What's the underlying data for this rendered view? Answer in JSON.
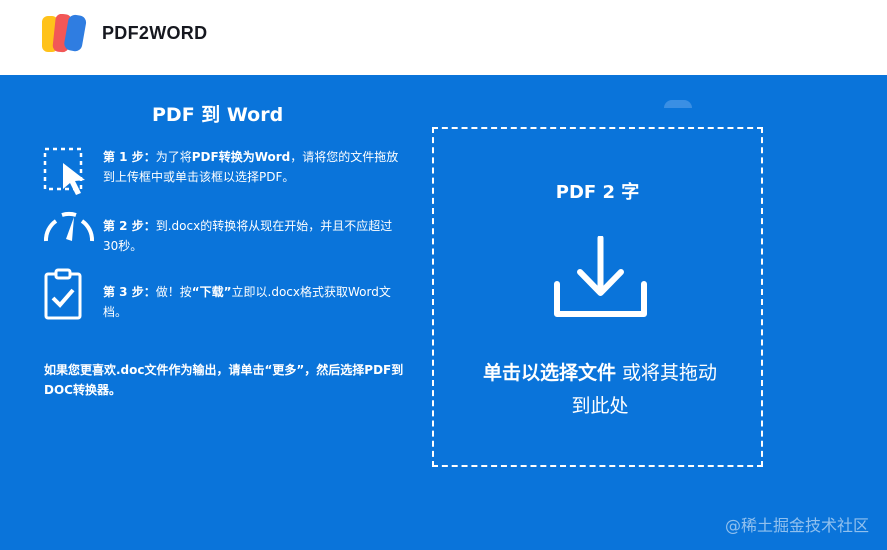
{
  "header": {
    "logo_text": "PDF2WORD"
  },
  "steps": {
    "title": "PDF 到 Word",
    "items": [
      {
        "icon": "cursor-select-icon",
        "label": "第 1 步：",
        "text_a": "为了将",
        "text_bold": "PDF转换为Word",
        "text_b": "，请将您的文件拖放到上传框中或单击该框以选择PDF。"
      },
      {
        "icon": "gauge-icon",
        "label": "第 2 步：",
        "text": "到.docx的转换将从现在开始，并且不应超过30秒。"
      },
      {
        "icon": "clipboard-check-icon",
        "label": "第 3 步：",
        "text_a": "做！按",
        "text_bold": "“下载”",
        "text_b": "立即以.docx格式获取Word文档。"
      }
    ],
    "note": "如果您更喜欢.doc文件作为输出，请单击“更多”，然后选择PDF到DOC转换器。"
  },
  "dropzone": {
    "title": "PDF 2 字",
    "icon": "download-icon",
    "text_bold": "单击以选择文件",
    "text_rest": " 或将其拖动到此处"
  },
  "watermark": "@稀土掘金技术社区",
  "colors": {
    "background": "#0a74da",
    "header": "#ffffff",
    "text": "#ffffff"
  }
}
